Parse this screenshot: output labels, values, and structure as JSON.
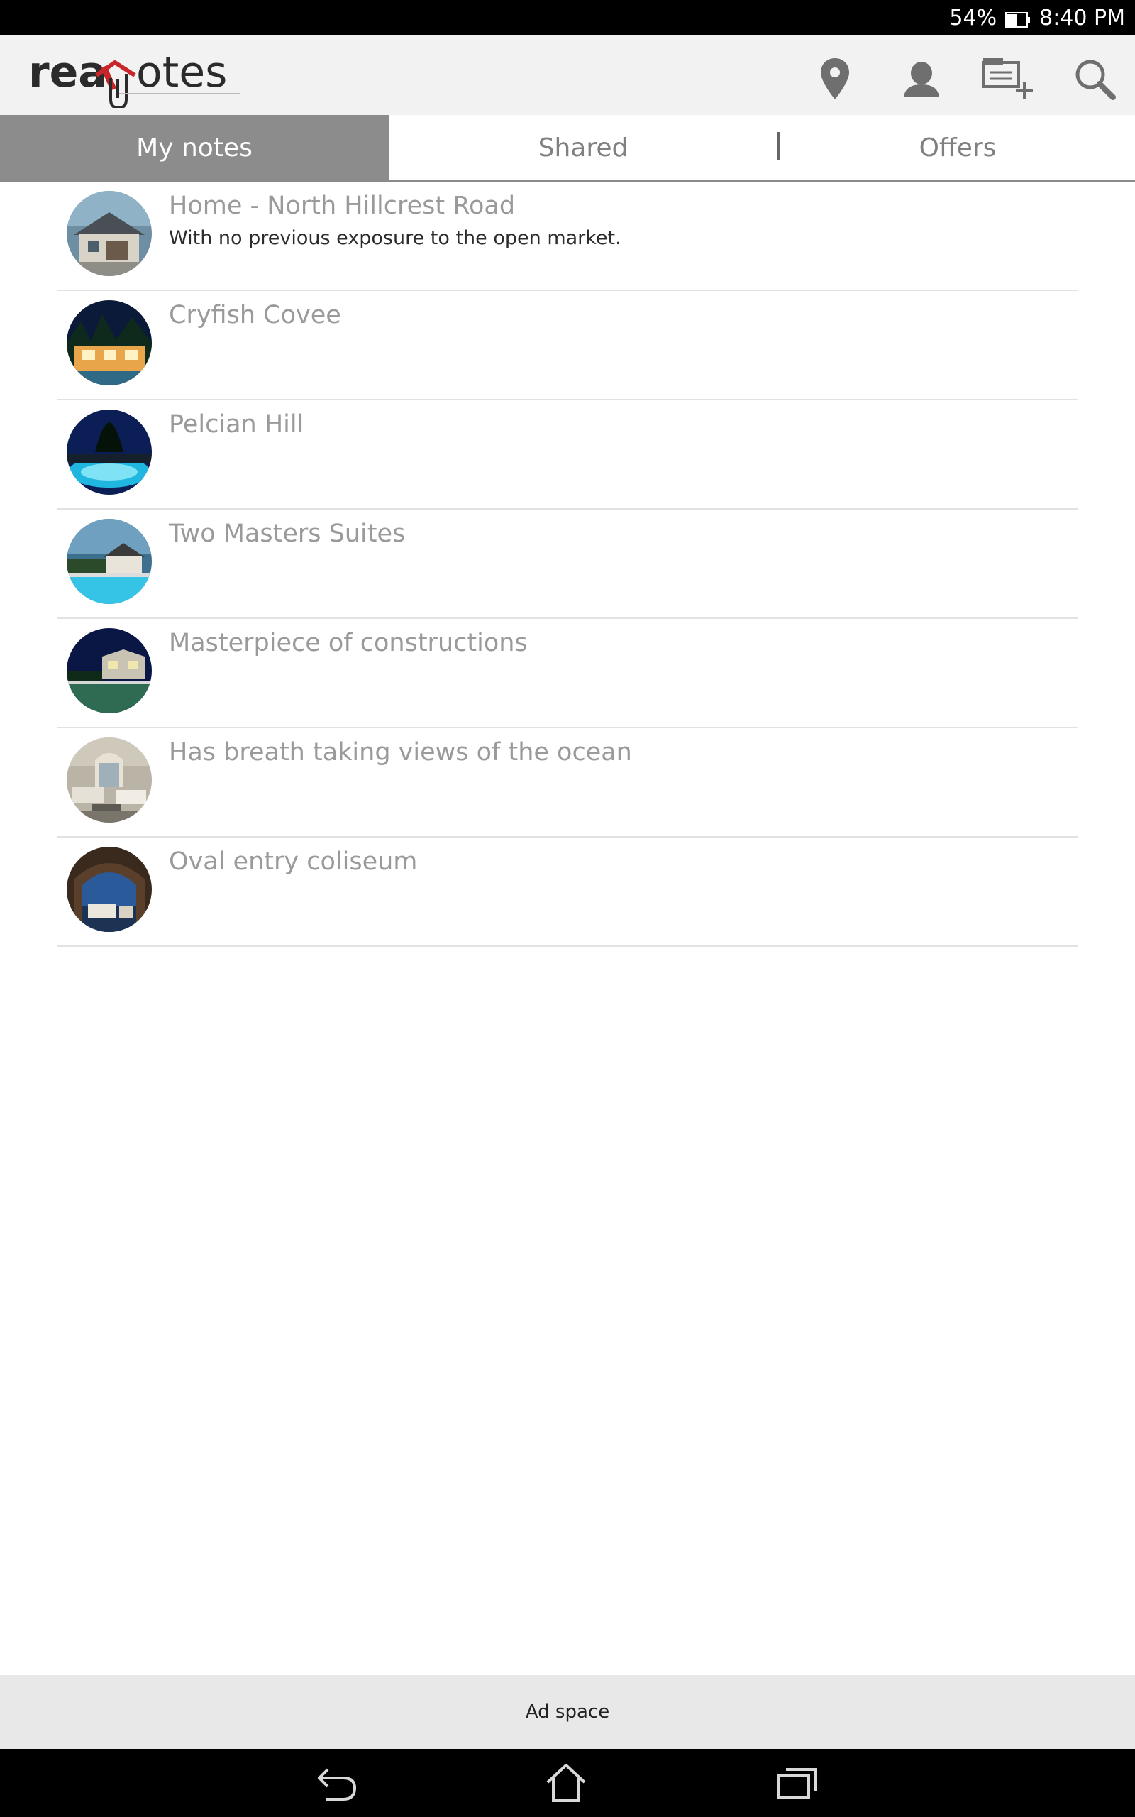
{
  "status_bar": {
    "battery": "54%",
    "time": "8:40 PM"
  },
  "app_bar": {
    "logo_text": "realnotes",
    "actions": [
      {
        "name": "location",
        "icon": "location-pin-icon"
      },
      {
        "name": "profile",
        "icon": "user-icon"
      },
      {
        "name": "add-note",
        "icon": "add-note-icon"
      },
      {
        "name": "search",
        "icon": "search-icon"
      }
    ]
  },
  "tabs": [
    {
      "label": "My notes",
      "active": true
    },
    {
      "label": "Shared",
      "active": false
    },
    {
      "label": "Offers",
      "active": false
    }
  ],
  "notes": [
    {
      "title": "Home - North Hillcrest Road",
      "subtitle": "With no previous exposure to the open market."
    },
    {
      "title": "Cryfish Covee",
      "subtitle": ""
    },
    {
      "title": "Pelcian Hill",
      "subtitle": ""
    },
    {
      "title": "Two Masters Suites",
      "subtitle": ""
    },
    {
      "title": "Masterpiece of constructions",
      "subtitle": ""
    },
    {
      "title": "Has breath taking views of the ocean",
      "subtitle": ""
    },
    {
      "title": "Oval entry coliseum",
      "subtitle": ""
    }
  ],
  "ad": {
    "label": "Ad space"
  },
  "nav_bar": {
    "buttons": [
      "back-icon",
      "home-icon",
      "recent-apps-icon"
    ]
  },
  "colors": {
    "active_tab": "#8c8c8c",
    "logo_accent": "#c8262a",
    "icon_gray": "#6f6f6f"
  }
}
